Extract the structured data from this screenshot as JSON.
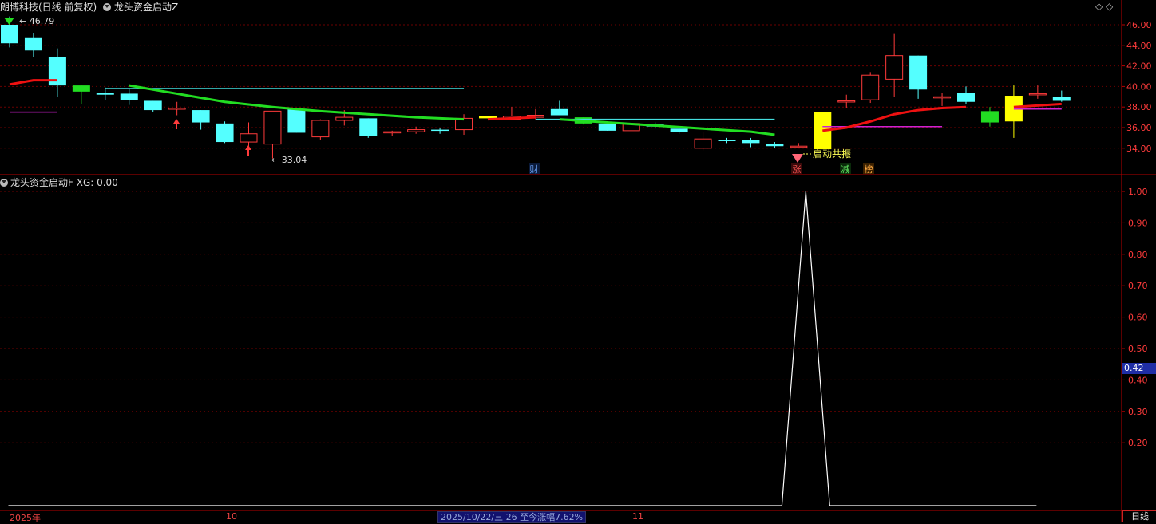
{
  "header": {
    "stock_label": "朗博科技(日线 前复权)",
    "indicator_label": "龙头资金启动Z"
  },
  "sub_header": {
    "indicator_label": "龙头资金启动F",
    "xg_label": "XG: 0.00"
  },
  "annotations": {
    "high_value": "46.79",
    "low_value": "33.04",
    "signal_text": "启动共振",
    "markers": [
      "财",
      "涨",
      "减",
      "榜"
    ]
  },
  "x_axis": {
    "labels": [
      "2025年",
      "10",
      "11"
    ]
  },
  "status_bar": {
    "text": "2025/10/22/三 26 至今涨幅7.62%"
  },
  "right_panel": {
    "current_value": "0.42",
    "period_button": "日线"
  },
  "colors": {
    "up": "#ff3b3b",
    "down": "#54ffff",
    "grid": "#6b0000",
    "axis": "#b80000",
    "ma_green": "#22dd22",
    "ma_red": "#ee1111",
    "cyan_line": "#44dddd",
    "magenta_line": "#d020d0",
    "yellow": "#ffff00"
  },
  "chart_data": [
    {
      "type": "candlestick",
      "y_ticks": [
        "46.00",
        "44.00",
        "42.00",
        "40.00",
        "38.00",
        "36.00",
        "34.00"
      ],
      "ylim": [
        32.6,
        47.2
      ],
      "candles": [
        {
          "o": 46.0,
          "h": 46.8,
          "l": 43.8,
          "c": 44.2,
          "color": "down"
        },
        {
          "o": 44.7,
          "h": 45.2,
          "l": 42.9,
          "c": 43.5,
          "color": "down"
        },
        {
          "o": 42.9,
          "h": 43.7,
          "l": 39.0,
          "c": 40.1,
          "color": "down"
        },
        {
          "o": 40.1,
          "h": 40.1,
          "l": 38.3,
          "c": 39.5,
          "color": "green"
        },
        {
          "o": 39.4,
          "h": 39.9,
          "l": 38.7,
          "c": 39.2,
          "color": "down"
        },
        {
          "o": 39.3,
          "h": 39.8,
          "l": 38.2,
          "c": 38.7,
          "color": "down"
        },
        {
          "o": 38.6,
          "h": 38.6,
          "l": 37.5,
          "c": 37.7,
          "color": "down"
        },
        {
          "o": 37.8,
          "h": 38.5,
          "l": 37.2,
          "c": 37.9,
          "color": "up"
        },
        {
          "o": 37.7,
          "h": 37.7,
          "l": 35.8,
          "c": 36.5,
          "color": "down"
        },
        {
          "o": 36.4,
          "h": 36.6,
          "l": 34.5,
          "c": 34.6,
          "color": "down"
        },
        {
          "o": 34.6,
          "h": 36.5,
          "l": 34.0,
          "c": 35.4,
          "color": "up"
        },
        {
          "o": 34.4,
          "h": 37.6,
          "l": 33.0,
          "c": 37.6,
          "color": "up"
        },
        {
          "o": 37.8,
          "h": 37.9,
          "l": 35.5,
          "c": 35.5,
          "color": "down"
        },
        {
          "o": 35.1,
          "h": 36.8,
          "l": 34.8,
          "c": 36.7,
          "color": "up"
        },
        {
          "o": 36.7,
          "h": 37.7,
          "l": 36.2,
          "c": 37.0,
          "color": "up"
        },
        {
          "o": 36.9,
          "h": 36.9,
          "l": 35.0,
          "c": 35.2,
          "color": "down"
        },
        {
          "o": 35.6,
          "h": 35.7,
          "l": 35.2,
          "c": 35.5,
          "color": "up"
        },
        {
          "o": 35.6,
          "h": 36.1,
          "l": 35.4,
          "c": 35.8,
          "color": "up"
        },
        {
          "o": 35.7,
          "h": 36.0,
          "l": 35.4,
          "c": 35.8,
          "color": "down"
        },
        {
          "o": 35.8,
          "h": 37.3,
          "l": 35.3,
          "c": 36.9,
          "color": "up"
        },
        {
          "o": 37.1,
          "h": 37.1,
          "l": 36.9,
          "c": 36.9,
          "color": "yellow"
        },
        {
          "o": 36.8,
          "h": 38.0,
          "l": 36.7,
          "c": 37.1,
          "color": "up"
        },
        {
          "o": 37.2,
          "h": 37.8,
          "l": 36.8,
          "c": 37.0,
          "color": "up"
        },
        {
          "o": 37.8,
          "h": 38.6,
          "l": 37.2,
          "c": 37.2,
          "color": "down"
        },
        {
          "o": 37.0,
          "h": 37.0,
          "l": 36.3,
          "c": 36.4,
          "color": "green"
        },
        {
          "o": 36.4,
          "h": 36.4,
          "l": 35.7,
          "c": 35.7,
          "color": "down"
        },
        {
          "o": 35.7,
          "h": 36.4,
          "l": 35.7,
          "c": 36.4,
          "color": "up"
        },
        {
          "o": 36.3,
          "h": 36.5,
          "l": 35.9,
          "c": 36.1,
          "color": "down"
        },
        {
          "o": 35.9,
          "h": 36.1,
          "l": 35.4,
          "c": 35.6,
          "color": "down"
        },
        {
          "o": 34.0,
          "h": 35.6,
          "l": 33.8,
          "c": 34.9,
          "color": "up"
        },
        {
          "o": 34.8,
          "h": 35.0,
          "l": 34.5,
          "c": 34.7,
          "color": "down"
        },
        {
          "o": 34.8,
          "h": 35.0,
          "l": 34.1,
          "c": 34.5,
          "color": "down"
        },
        {
          "o": 34.4,
          "h": 34.6,
          "l": 34.0,
          "c": 34.2,
          "color": "down"
        },
        {
          "o": 34.1,
          "h": 34.5,
          "l": 34.0,
          "c": 34.2,
          "color": "up"
        },
        {
          "o": 37.5,
          "h": 37.5,
          "l": 33.9,
          "c": 33.9,
          "color": "yellow"
        },
        {
          "o": 38.6,
          "h": 39.2,
          "l": 37.9,
          "c": 38.6,
          "color": "up"
        },
        {
          "o": 38.7,
          "h": 41.4,
          "l": 38.4,
          "c": 41.1,
          "color": "up"
        },
        {
          "o": 40.7,
          "h": 45.1,
          "l": 39.0,
          "c": 43.0,
          "color": "up"
        },
        {
          "o": 43.0,
          "h": 43.0,
          "l": 38.8,
          "c": 39.7,
          "color": "down"
        },
        {
          "o": 39.0,
          "h": 39.4,
          "l": 38.1,
          "c": 39.0,
          "color": "up"
        },
        {
          "o": 39.4,
          "h": 40.0,
          "l": 38.3,
          "c": 38.5,
          "color": "down"
        },
        {
          "o": 37.6,
          "h": 38.0,
          "l": 36.1,
          "c": 36.5,
          "color": "green"
        },
        {
          "o": 36.6,
          "h": 40.1,
          "l": 35.0,
          "c": 39.1,
          "color": "yellow"
        },
        {
          "o": 39.3,
          "h": 40.1,
          "l": 38.8,
          "c": 39.3,
          "color": "up"
        },
        {
          "o": 39.0,
          "h": 39.6,
          "l": 38.5,
          "c": 38.6,
          "color": "down"
        }
      ],
      "lines": [
        {
          "color": "ma_red",
          "points": [
            [
              0,
              40.2
            ],
            [
              1,
              40.6
            ],
            [
              2,
              40.6
            ]
          ]
        },
        {
          "color": "magenta_line",
          "points": [
            [
              0,
              37.5
            ],
            [
              2,
              37.5
            ]
          ]
        },
        {
          "color": "cyan_line",
          "points": [
            [
              4,
              39.8
            ],
            [
              19,
              39.8
            ]
          ]
        },
        {
          "color": "ma_green",
          "points": [
            [
              5,
              40.1
            ],
            [
              7,
              39.3
            ],
            [
              9,
              38.5
            ],
            [
              11,
              38.0
            ],
            [
              13,
              37.6
            ],
            [
              15,
              37.3
            ],
            [
              17,
              37.0
            ],
            [
              19,
              36.8
            ]
          ]
        },
        {
          "color": "ma_red",
          "points": [
            [
              20,
              36.8
            ],
            [
              22,
              37.0
            ]
          ]
        },
        {
          "color": "cyan_line",
          "points": [
            [
              22,
              36.8
            ],
            [
              32,
              36.8
            ]
          ]
        },
        {
          "color": "ma_green",
          "points": [
            [
              23,
              36.8
            ],
            [
              25,
              36.5
            ],
            [
              27,
              36.2
            ],
            [
              29,
              35.9
            ],
            [
              31,
              35.6
            ],
            [
              32,
              35.3
            ]
          ]
        },
        {
          "color": "magenta_line",
          "points": [
            [
              34,
              36.1
            ],
            [
              39,
              36.1
            ]
          ]
        },
        {
          "color": "ma_red",
          "points": [
            [
              34,
              35.7
            ],
            [
              35,
              36.0
            ],
            [
              36,
              36.6
            ],
            [
              37,
              37.3
            ],
            [
              38,
              37.7
            ],
            [
              39,
              37.9
            ],
            [
              40,
              38.0
            ]
          ]
        },
        {
          "color": "ma_red",
          "points": [
            [
              42,
              38.0
            ],
            [
              44,
              38.3
            ]
          ]
        },
        {
          "color": "magenta_line",
          "points": [
            [
              42,
              37.8
            ],
            [
              44,
              37.8
            ]
          ]
        }
      ]
    },
    {
      "type": "line",
      "y_ticks": [
        "1.00",
        "0.90",
        "0.80",
        "0.70",
        "0.60",
        "0.50",
        "0.40",
        "0.30",
        "0.20"
      ],
      "ylim": [
        0,
        1.0
      ],
      "series": [
        {
          "points": [
            [
              -0.05,
              0
            ],
            [
              32.3,
              0
            ],
            [
              33.3,
              1.0
            ],
            [
              34.3,
              0
            ],
            [
              42.95,
              0
            ]
          ]
        }
      ]
    }
  ]
}
